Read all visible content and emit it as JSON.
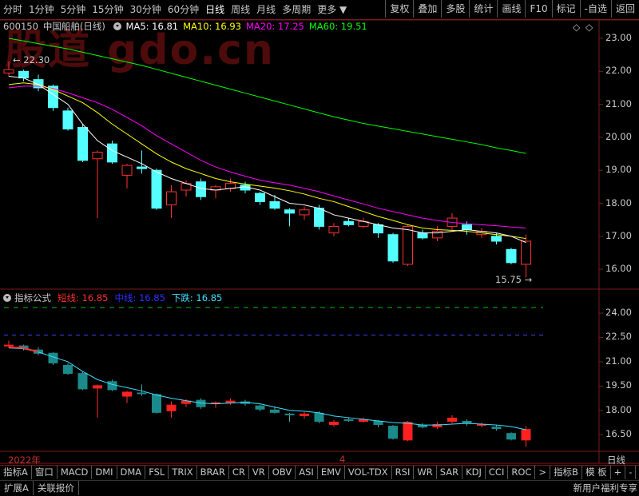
{
  "toolbar": {
    "periods": [
      "分时",
      "1分钟",
      "5分钟",
      "15分钟",
      "30分钟",
      "60分钟",
      "日线",
      "周线",
      "月线",
      "多周期",
      "更多"
    ],
    "active_period": "日线",
    "right_buttons": [
      "复权",
      "叠加",
      "多股",
      "统计",
      "画线",
      "F10",
      "标记",
      "-自选",
      "返回"
    ]
  },
  "watermark": "股道 gdo.cn",
  "stock": {
    "code": "600150",
    "name": "中国船舶",
    "period": "(日线)"
  },
  "ma_legend": [
    {
      "label": "MA5: 16.81",
      "color": "#ffffff"
    },
    {
      "label": "MA10: 16.93",
      "color": "#ffff00"
    },
    {
      "label": "MA20: 17.25",
      "color": "#ff00ff"
    },
    {
      "label": "MA60: 19.51",
      "color": "#00ff00"
    }
  ],
  "price_axis": [
    "23.00",
    "22.00",
    "21.00",
    "20.00",
    "19.00",
    "18.00",
    "17.00",
    "16.00"
  ],
  "high_label": "22.30",
  "low_label": "15.75",
  "indicator": {
    "name": "指标公式",
    "lines": [
      {
        "label": "短线: 16.85",
        "color": "#ff3030"
      },
      {
        "label": "中线: 16.85",
        "color": "#3030ff"
      },
      {
        "label": "下跌: 16.85",
        "color": "#40e0ff"
      }
    ],
    "axis": [
      "24.00",
      "22.50",
      "21.00",
      "19.50",
      "18.00",
      "16.50"
    ]
  },
  "time_axis": {
    "left": "2022年",
    "mid": "4",
    "right": "日线"
  },
  "bottom_tabs": [
    "指标A",
    "窗口",
    "MACD",
    "DMI",
    "DMA",
    "FSL",
    "TRIX",
    "BRAR",
    "CR",
    "VR",
    "OBV",
    "ASI",
    "EMV",
    "VOL-TDX",
    "RSI",
    "WR",
    "SAR",
    "KDJ",
    "CCI",
    "ROC",
    ">",
    "指标B",
    "模 板",
    "+",
    "-"
  ],
  "status": {
    "left": [
      "扩展A",
      "关联报价"
    ],
    "right": "新用户福利专享"
  },
  "chart_data": {
    "type": "candlestick",
    "candles": [
      [
        21.95,
        22.05,
        22.3,
        21.85
      ],
      [
        22.0,
        21.8,
        22.05,
        21.7
      ],
      [
        21.75,
        21.5,
        21.9,
        21.4
      ],
      [
        21.55,
        20.9,
        21.6,
        20.8
      ],
      [
        20.8,
        20.25,
        20.9,
        20.2
      ],
      [
        20.3,
        19.3,
        20.4,
        19.25
      ],
      [
        19.35,
        19.55,
        19.6,
        17.55
      ],
      [
        19.8,
        19.25,
        19.9,
        19.2
      ],
      [
        18.85,
        19.15,
        19.2,
        18.45
      ],
      [
        19.1,
        19.05,
        19.6,
        18.9
      ],
      [
        19.0,
        17.85,
        19.05,
        17.8
      ],
      [
        17.95,
        18.35,
        18.55,
        17.55
      ],
      [
        18.4,
        18.6,
        18.7,
        18.2
      ],
      [
        18.65,
        18.2,
        18.75,
        18.1
      ],
      [
        18.4,
        18.5,
        18.55,
        18.15
      ],
      [
        18.45,
        18.6,
        18.75,
        18.35
      ],
      [
        18.55,
        18.4,
        18.65,
        18.3
      ],
      [
        18.3,
        18.05,
        18.35,
        17.95
      ],
      [
        18.05,
        17.85,
        18.25,
        17.8
      ],
      [
        17.8,
        17.7,
        17.85,
        17.3
      ],
      [
        17.65,
        17.8,
        17.9,
        17.5
      ],
      [
        17.85,
        17.3,
        17.95,
        17.2
      ],
      [
        17.1,
        17.3,
        17.4,
        17.0
      ],
      [
        17.45,
        17.35,
        17.55,
        17.3
      ],
      [
        17.3,
        17.45,
        17.55,
        17.25
      ],
      [
        17.35,
        17.1,
        17.4,
        16.95
      ],
      [
        17.05,
        16.25,
        17.1,
        16.2
      ],
      [
        16.15,
        17.3,
        17.35,
        16.1
      ],
      [
        17.1,
        16.95,
        17.2,
        16.9
      ],
      [
        16.95,
        17.15,
        17.3,
        16.85
      ],
      [
        17.3,
        17.55,
        17.7,
        17.2
      ],
      [
        17.35,
        17.2,
        17.45,
        17.05
      ],
      [
        17.05,
        17.15,
        17.25,
        16.95
      ],
      [
        17.0,
        16.85,
        17.1,
        16.75
      ],
      [
        16.6,
        16.2,
        16.65,
        16.15
      ],
      [
        16.15,
        16.85,
        17.05,
        15.75
      ]
    ],
    "ma5": [
      21.85,
      21.8,
      21.6,
      21.3,
      21.0,
      20.4,
      19.9,
      19.6,
      19.4,
      19.2,
      18.95,
      18.75,
      18.6,
      18.45,
      18.4,
      18.45,
      18.5,
      18.4,
      18.2,
      18.0,
      17.95,
      17.85,
      17.65,
      17.55,
      17.45,
      17.35,
      17.25,
      17.2,
      17.1,
      17.1,
      17.15,
      17.2,
      17.15,
      17.1,
      17.0,
      16.81
    ],
    "ma10": [
      21.6,
      21.65,
      21.6,
      21.45,
      21.25,
      21.05,
      20.75,
      20.4,
      20.1,
      19.8,
      19.5,
      19.25,
      19.05,
      18.9,
      18.75,
      18.65,
      18.58,
      18.52,
      18.46,
      18.38,
      18.28,
      18.15,
      18.05,
      17.9,
      17.75,
      17.6,
      17.48,
      17.35,
      17.25,
      17.2,
      17.18,
      17.15,
      17.1,
      17.05,
      17.0,
      16.93
    ],
    "ma20": [
      21.5,
      21.55,
      21.55,
      21.48,
      21.35,
      21.2,
      21.05,
      20.85,
      20.6,
      20.35,
      20.05,
      19.8,
      19.55,
      19.3,
      19.1,
      18.95,
      18.82,
      18.7,
      18.62,
      18.55,
      18.45,
      18.35,
      18.22,
      18.1,
      17.98,
      17.85,
      17.75,
      17.65,
      17.55,
      17.48,
      17.42,
      17.38,
      17.35,
      17.32,
      17.28,
      17.25
    ],
    "ma60": [
      23.0,
      22.92,
      22.84,
      22.76,
      22.68,
      22.58,
      22.48,
      22.38,
      22.28,
      22.18,
      22.06,
      21.94,
      21.82,
      21.7,
      21.58,
      21.46,
      21.34,
      21.22,
      21.1,
      20.98,
      20.86,
      20.74,
      20.62,
      20.52,
      20.42,
      20.34,
      20.26,
      20.18,
      20.1,
      20.02,
      19.94,
      19.86,
      19.78,
      19.68,
      19.6,
      19.51
    ]
  }
}
